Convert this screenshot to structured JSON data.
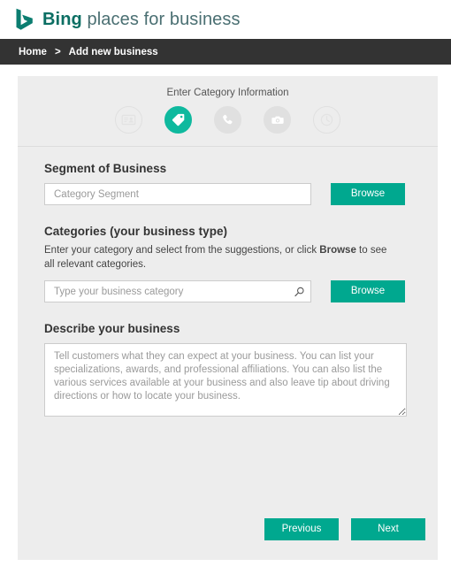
{
  "brand": {
    "logo_icon": "bing-b-logo-icon",
    "name_bold": "Bing",
    "name_light": " places for business",
    "logo_color": "#0b6e63"
  },
  "breadcrumb": {
    "home_label": "Home",
    "separator": ">",
    "current_label": "Add new business"
  },
  "stepper": {
    "title": "Enter Category Information",
    "steps": [
      {
        "icon": "business-card-icon",
        "state": "outline",
        "name": "step-business-info"
      },
      {
        "icon": "tag-icon",
        "state": "active",
        "name": "step-category-info"
      },
      {
        "icon": "phone-icon",
        "state": "filled",
        "name": "step-contact-info"
      },
      {
        "icon": "camera-icon",
        "state": "filled",
        "name": "step-photos"
      },
      {
        "icon": "clock-icon",
        "state": "outline",
        "name": "step-hours"
      }
    ],
    "active_color": "#0FB99E",
    "inactive_color": "#e0e0e0"
  },
  "form": {
    "segment": {
      "label": "Segment of Business",
      "placeholder": "Category Segment",
      "value": "",
      "browse_label": "Browse"
    },
    "categories": {
      "label": "Categories (your business type)",
      "helper_prefix": "Enter your category and select from the suggestions, or click ",
      "helper_bold": "Browse",
      "helper_suffix": " to see all relevant categories.",
      "placeholder": "Type your business category",
      "value": "",
      "search_icon": "search-icon",
      "browse_label": "Browse"
    },
    "describe": {
      "label": "Describe your business",
      "placeholder": "Tell customers what they can expect at your business. You can list your specializations, awards, and professional affiliations. You can also list the various services available at your business and also leave tip about driving directions or how to locate your business.",
      "value": ""
    }
  },
  "footer": {
    "previous_label": "Previous",
    "next_label": "Next",
    "button_color": "#00a88f"
  }
}
